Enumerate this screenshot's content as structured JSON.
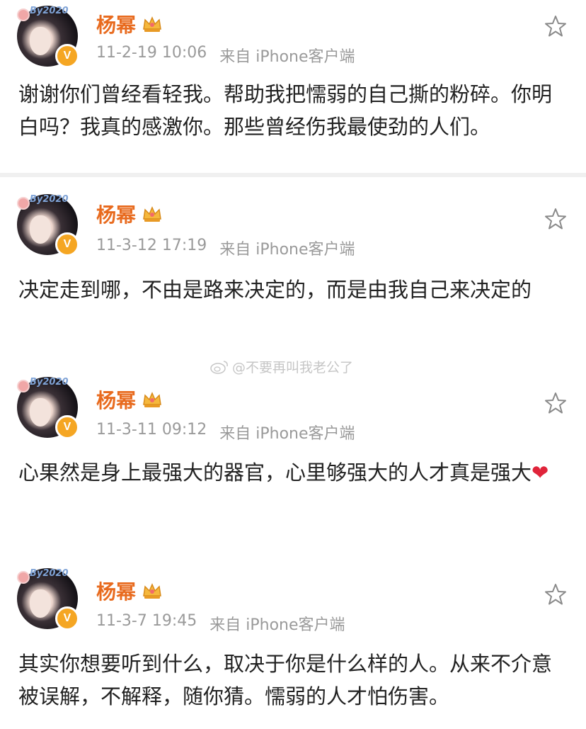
{
  "colors": {
    "username": "#e86b1f",
    "meta": "#9a9a9a",
    "text": "#222222",
    "badge": "#f5a623",
    "heart": "#e0243a"
  },
  "avatar_deco_text": "By2020",
  "posts": [
    {
      "username": "杨幂",
      "time": "11-2-19 10:06",
      "source": "来自 iPhone客户端",
      "text": "谢谢你们曾经看轻我。帮助我把懦弱的自己撕的粉碎。你明白吗？我真的感激你。那些曾经伤我最使劲的人们。"
    },
    {
      "username": "杨幂",
      "time": "11-3-12 17:19",
      "source": "来自 iPhone客户端",
      "text": "决定走到哪，不由是路来决定的，而是由我自己来决定的"
    },
    {
      "username": "杨幂",
      "time": "11-3-11 09:12",
      "source": "来自 iPhone客户端",
      "text": "心果然是身上最强大的器官，心里够强大的人才真是强大",
      "emoji": "❤"
    },
    {
      "username": "杨幂",
      "time": "11-3-7 19:45",
      "source": "来自 iPhone客户端",
      "text": "其实你想要听到什么，取决于你是什么样的人。从来不介意被误解，不解释，随你猜。懦弱的人才怕伤害。"
    }
  ],
  "watermark": "@不要再叫我老公了",
  "verified_mark": "V"
}
